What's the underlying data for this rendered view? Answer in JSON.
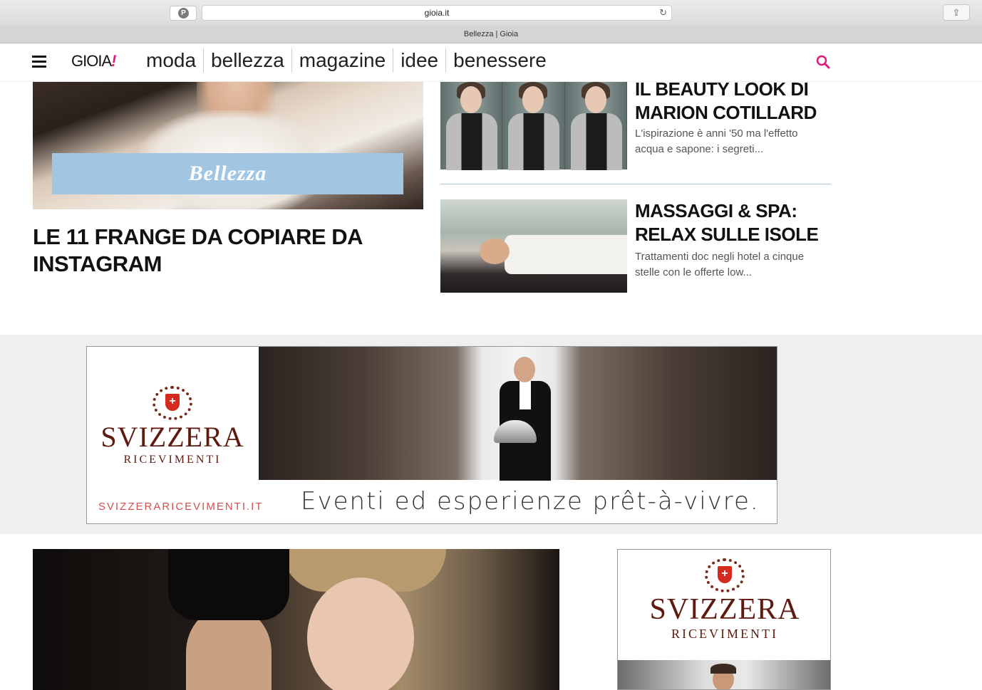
{
  "browser": {
    "url": "gioia.it",
    "tab_title": "Bellezza | Gioia"
  },
  "header": {
    "logo_text": "GIOIA",
    "logo_mark": "!",
    "nav": [
      "moda",
      "bellezza",
      "magazine",
      "idee",
      "benessere"
    ],
    "accent_color": "#e2187c"
  },
  "hero": {
    "category": "Bellezza",
    "title": "LE 11 FRANGE DA COPIARE DA INSTAGRAM"
  },
  "side_articles": [
    {
      "title": "IL BEAUTY LOOK DI MARION COTILLARD",
      "excerpt": "L'ispirazione è anni '50 ma l'effetto acqua e sapone: i segreti..."
    },
    {
      "title": "MASSAGGI & SPA: RELAX SULLE ISOLE",
      "excerpt": "Trattamenti doc negli hotel a cinque stelle con le offerte low..."
    }
  ],
  "ad_banner": {
    "brand": "SVIZZERA",
    "brand_sub": "RICEVIMENTI",
    "url": "SVIZZERARICEVIMENTI.IT",
    "tagline": "Eventi ed esperienze prêt-à-vivre."
  },
  "side_ad": {
    "brand": "SVIZZERA",
    "brand_sub": "RICEVIMENTI"
  }
}
